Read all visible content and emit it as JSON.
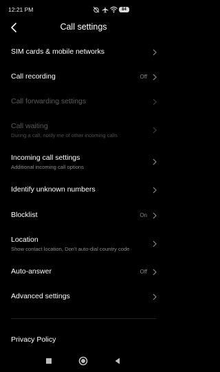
{
  "status_bar": {
    "time": "12:21 PM",
    "battery": "84",
    "icons": [
      "alarm-off-icon",
      "airplane-icon",
      "wifi-icon",
      "battery-icon"
    ]
  },
  "header": {
    "title": "Call settings",
    "back_icon": "back-arrow-icon"
  },
  "settings": [
    {
      "label": "SIM cards & mobile networks",
      "sub": "",
      "value": "",
      "enabled": true
    },
    {
      "label": "Call recording",
      "sub": "",
      "value": "Off",
      "enabled": true
    },
    {
      "label": "Call forwarding settings",
      "sub": "",
      "value": "",
      "enabled": false
    },
    {
      "label": "Call waiting",
      "sub": "During a call, notify me of other incoming calls",
      "value": "",
      "enabled": false
    },
    {
      "label": "Incoming call settings",
      "sub": "Additional incoming call options",
      "value": "",
      "enabled": true
    },
    {
      "label": "Identify unknown numbers",
      "sub": "",
      "value": "",
      "enabled": true
    },
    {
      "label": "Blocklist",
      "sub": "",
      "value": "On",
      "enabled": true
    },
    {
      "label": "Location",
      "sub": "Show contact location, Don't auto-dial country code",
      "value": "",
      "enabled": true
    },
    {
      "label": "Auto-answer",
      "sub": "",
      "value": "Off",
      "enabled": true
    },
    {
      "label": "Advanced settings",
      "sub": "",
      "value": "",
      "enabled": true
    }
  ],
  "footer": {
    "privacy_policy": "Privacy Policy"
  },
  "nav_bar": {
    "buttons": [
      "recents-square-icon",
      "home-circle-icon",
      "back-triangle-icon"
    ]
  },
  "colors": {
    "background": "#000000",
    "text_primary": "#ffffff",
    "text_secondary": "#8a8a8a",
    "text_disabled": "#5a5a5a"
  }
}
